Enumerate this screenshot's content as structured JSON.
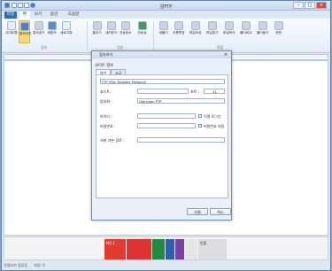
{
  "window": {
    "title": "알FTP"
  },
  "ribbon_tabs": [
    "파일",
    "편",
    "보기",
    "옵션",
    "도움말"
  ],
  "ribbon_buttons": [
    {
      "name": "site-manager",
      "label": "사이트맵"
    },
    {
      "name": "connect",
      "label": "접속하기"
    },
    {
      "name": "disconnect",
      "label": "접속끊기"
    },
    {
      "name": "reconnect",
      "label": "재접속"
    },
    {
      "name": "refresh",
      "label": "새로고침"
    },
    {
      "name": "upload",
      "label": "올리기"
    },
    {
      "name": "download",
      "label": "내려받기"
    },
    {
      "name": "delete",
      "label": "전송취소"
    },
    {
      "name": "queue",
      "label": "전송큐"
    },
    {
      "name": "newfolder",
      "label": "새폴더"
    },
    {
      "name": "rename",
      "label": "이름변경"
    },
    {
      "name": "attr",
      "label": "파일속성"
    },
    {
      "name": "move",
      "label": "파일찾기"
    },
    {
      "name": "copy",
      "label": "파일복사"
    },
    {
      "name": "compare",
      "label": "폴더비교"
    },
    {
      "name": "sync",
      "label": "폴더동기"
    },
    {
      "name": "perm",
      "label": "권한"
    }
  ],
  "ribbon_groups": [
    "접속",
    "전송",
    "편집"
  ],
  "dialog": {
    "title": "접속하기",
    "subtitle": "사이트 정보",
    "tabs": [
      "일반",
      "고급"
    ],
    "protocol": "FTP (File Transfer Protocol)",
    "host_label": "호스트 :",
    "port_label": "포트 :",
    "port_value": "21",
    "encryption_label": "암호화 :",
    "encryption_value": "Use plain FTP",
    "id_label": "아이디 :",
    "anonymous_label": "익명 로그인",
    "password_label": "비밀번호 :",
    "save_password_label": "비밀번호 저장",
    "remote_path_label": "서버 기본 경로 :",
    "connect_button": "연결",
    "cancel_button": "취소"
  },
  "status": {
    "left": "연결되지 않았음",
    "right": "파일: 0"
  },
  "ad": {
    "text1": "NO.1",
    "text2": "포켓파이",
    "text3": "빈폴"
  }
}
